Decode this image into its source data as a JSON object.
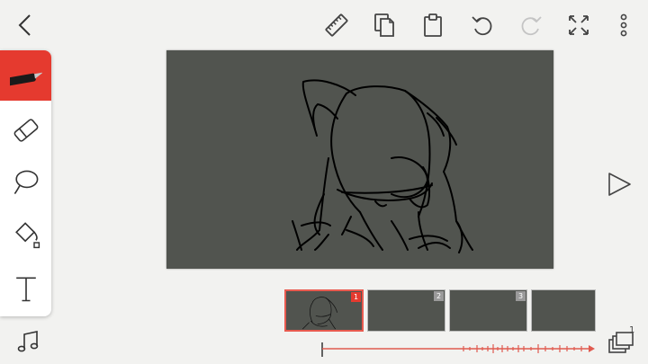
{
  "colors": {
    "accent": "#e53a2f",
    "canvas_bg": "#51544f",
    "sketch_line": "#000000",
    "panel_bg": "#ffffff",
    "app_bg": "#f2f2f0"
  },
  "header": {
    "icons": [
      "back-icon",
      "ruler-icon",
      "copy-icon",
      "paste-icon",
      "undo-icon",
      "redo-icon",
      "fullscreen-icon",
      "more-icon"
    ]
  },
  "tools": [
    "pen",
    "eraser",
    "lasso",
    "fill",
    "text"
  ],
  "frames": [
    {
      "number": "1",
      "selected": true
    },
    {
      "number": "2",
      "selected": false
    },
    {
      "number": "3",
      "selected": false
    },
    {
      "number": "",
      "selected": false
    }
  ],
  "layers_badge": "1"
}
